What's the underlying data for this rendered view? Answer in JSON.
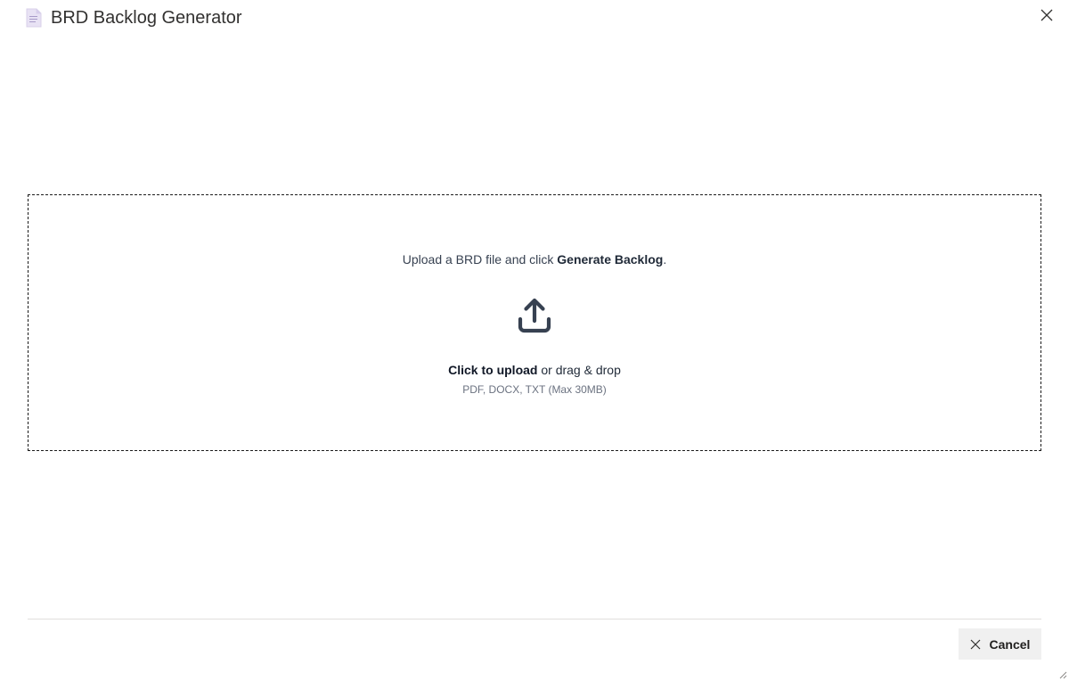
{
  "dialog": {
    "title": "BRD Backlog Generator",
    "icons": {
      "title": "document-icon",
      "close": "close-icon"
    }
  },
  "dropzone": {
    "instruction_prefix": "Upload a BRD file and click ",
    "instruction_action": "Generate Backlog",
    "instruction_suffix": ".",
    "upload_icon": "upload-icon",
    "cta_bold": "Click to upload",
    "cta_rest": " or drag & drop",
    "file_hint": "PDF, DOCX, TXT (Max 30MB)"
  },
  "footer": {
    "cancel_label": "Cancel",
    "cancel_icon": "close-icon"
  },
  "colors": {
    "icon_dark": "#374151",
    "doc_icon": "#e8e2f4",
    "border_dashed": "#1b1b1b",
    "button_bg": "#f0f0f0"
  }
}
